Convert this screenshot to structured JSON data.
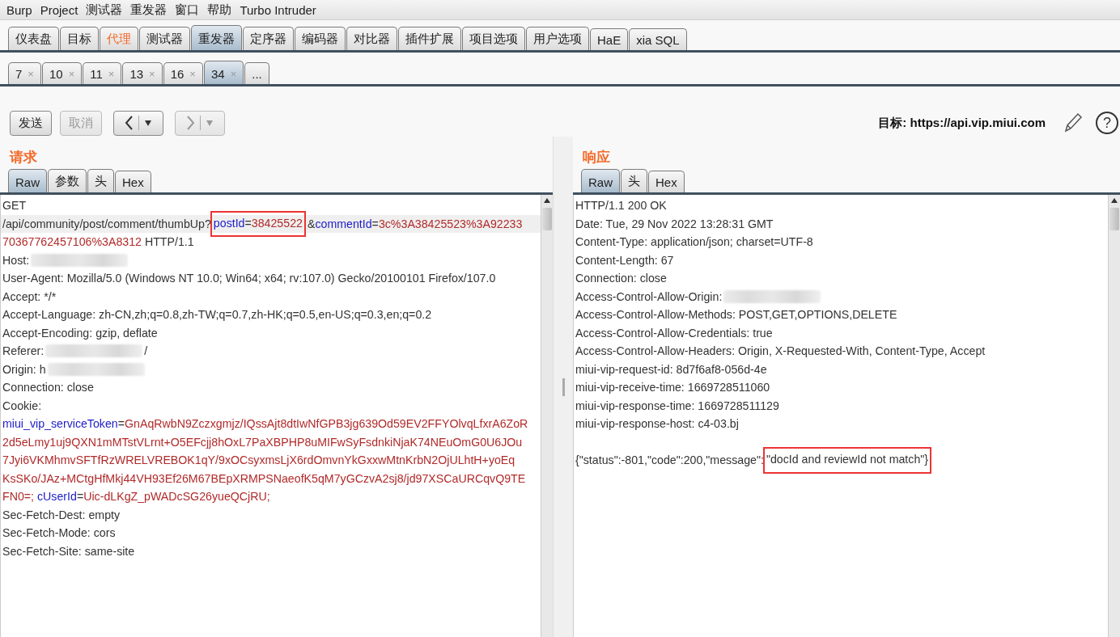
{
  "menu": [
    "Burp",
    "Project",
    "测试器",
    "重发器",
    "窗口",
    "帮助",
    "Turbo Intruder"
  ],
  "tool_tabs": [
    {
      "label": "仪表盘",
      "selected": false,
      "highlighted": false
    },
    {
      "label": "目标",
      "selected": false,
      "highlighted": false
    },
    {
      "label": "代理",
      "selected": false,
      "highlighted": true
    },
    {
      "label": "测试器",
      "selected": false,
      "highlighted": false
    },
    {
      "label": "重发器",
      "selected": true,
      "highlighted": false
    },
    {
      "label": "定序器",
      "selected": false,
      "highlighted": false
    },
    {
      "label": "编码器",
      "selected": false,
      "highlighted": false
    },
    {
      "label": "对比器",
      "selected": false,
      "highlighted": false
    },
    {
      "label": "插件扩展",
      "selected": false,
      "highlighted": false
    },
    {
      "label": "项目选项",
      "selected": false,
      "highlighted": false
    },
    {
      "label": "用户选项",
      "selected": false,
      "highlighted": false
    },
    {
      "label": "HaE",
      "selected": false,
      "highlighted": false
    },
    {
      "label": "xia SQL",
      "selected": false,
      "highlighted": false
    }
  ],
  "repeater_tabs": [
    {
      "label": "7",
      "close": "×",
      "selected": false
    },
    {
      "label": "10",
      "close": "×",
      "selected": false
    },
    {
      "label": "11",
      "close": "×",
      "selected": false
    },
    {
      "label": "13",
      "close": "×",
      "selected": false
    },
    {
      "label": "16",
      "close": "×",
      "selected": false
    },
    {
      "label": "34",
      "close": "×",
      "selected": true
    },
    {
      "label": "...",
      "selected": false
    }
  ],
  "toolbar": {
    "buttons": [
      {
        "kind": "text",
        "label": "发送",
        "disabled": false
      },
      {
        "kind": "text",
        "label": "取消",
        "disabled": true
      },
      {
        "kind": "back",
        "disabled": false
      },
      {
        "kind": "forward",
        "disabled": true
      }
    ],
    "target_label": "目标:",
    "target": "https://api.vip.miui.com",
    "help": "?"
  },
  "request": {
    "title": "请求",
    "tabs": [
      {
        "label": "Raw",
        "selected": true
      },
      {
        "label": "参数",
        "selected": false
      },
      {
        "label": "头",
        "selected": false
      },
      {
        "label": "Hex",
        "selected": false
      }
    ],
    "lines": [
      [
        {
          "kind": "plain",
          "text": "GET"
        }
      ],
      [
        {
          "kind": "plain",
          "text": "/api/community/post/comment/thumbUp?"
        },
        {
          "kind": "key",
          "text": "postId",
          "boxed": true
        },
        {
          "kind": "plain",
          "text": "=",
          "boxed": true
        },
        {
          "kind": "value",
          "text": "38425522",
          "boxed": true
        },
        {
          "kind": "plain",
          "text": "&"
        },
        {
          "kind": "key",
          "text": "commentId"
        },
        {
          "kind": "plain",
          "text": "="
        },
        {
          "kind": "value",
          "text": "3c%3A38425523%3A92233"
        }
      ],
      [
        {
          "kind": "value",
          "text": "70367762457106%3A8312"
        },
        {
          "kind": "plain",
          "text": " HTTP/1.1"
        }
      ],
      [
        {
          "kind": "plain",
          "text": "Host:"
        },
        {
          "kind": "redacted"
        }
      ],
      [
        {
          "kind": "plain",
          "text": "User-Agent: Mozilla/5.0 (Windows NT 10.0; Win64; x64; rv:107.0) Gecko/20100101 Firefox/107.0"
        }
      ],
      [
        {
          "kind": "plain",
          "text": "Accept: */*"
        }
      ],
      [
        {
          "kind": "plain",
          "text": "Accept-Language: zh-CN,zh;q=0.8,zh-TW;q=0.7,zh-HK;q=0.5,en-US;q=0.3,en;q=0.2"
        }
      ],
      [
        {
          "kind": "plain",
          "text": "Accept-Encoding: gzip, deflate"
        }
      ],
      [
        {
          "kind": "plain",
          "text": "Referer:"
        },
        {
          "kind": "redacted"
        },
        {
          "kind": "plain",
          "text": "/"
        }
      ],
      [
        {
          "kind": "plain",
          "text": "Origin: h"
        },
        {
          "kind": "redacted"
        }
      ],
      [
        {
          "kind": "plain",
          "text": "Connection: close"
        }
      ],
      [
        {
          "kind": "plain",
          "text": "Cookie:"
        }
      ],
      [
        {
          "kind": "key",
          "text": "miui_vip_serviceToken"
        },
        {
          "kind": "plain",
          "text": "="
        },
        {
          "kind": "value",
          "text": "GnAqRwbN9Zczxgmjz/IQssAjt8dtIwNfGPB3jg639Od59EV2FFYOlvqLfxrA6ZoR"
        }
      ],
      [
        {
          "kind": "value",
          "text": "2d5eLmy1uj9QXN1mMTstVLrnt+O5EFcjj8hOxL7PaXBPHP8uMIFwSyFsdnkiNjaK74NEuOmG0U6JOu"
        }
      ],
      [
        {
          "kind": "value",
          "text": "7Jyi6VKMhmvSFTfRzWRELVREBOK1qY/9xOCsyxmsLjX6rdOmvnYkGxxwMtnKrbN2OjULhtH+yoEq"
        }
      ],
      [
        {
          "kind": "value",
          "text": "KsSKo/JAz+MCtgHfMkj44VH93Ef26M67BEpXRMPSNaeofK5qM7yGCzvA2sj8/jd97XSCaURCqvQ9TE"
        }
      ],
      [
        {
          "kind": "value",
          "text": "FN0=; "
        },
        {
          "kind": "key",
          "text": "cUserId"
        },
        {
          "kind": "plain",
          "text": "="
        },
        {
          "kind": "value",
          "text": "Uic-dLKgZ_pWADcSG26yueQCjRU;"
        }
      ],
      [
        {
          "kind": "plain",
          "text": "Sec-Fetch-Dest: empty"
        }
      ],
      [
        {
          "kind": "plain",
          "text": "Sec-Fetch-Mode: cors"
        }
      ],
      [
        {
          "kind": "plain",
          "text": "Sec-Fetch-Site: same-site"
        }
      ]
    ]
  },
  "response": {
    "title": "响应",
    "tabs": [
      {
        "label": "Raw",
        "selected": true
      },
      {
        "label": "头",
        "selected": false
      },
      {
        "label": "Hex",
        "selected": false
      }
    ],
    "lines": [
      [
        {
          "kind": "plain",
          "text": "HTTP/1.1 200 OK"
        }
      ],
      [
        {
          "kind": "plain",
          "text": "Date: Tue, 29 Nov 2022 13:28:31 GMT"
        }
      ],
      [
        {
          "kind": "plain",
          "text": "Content-Type: application/json; charset=UTF-8"
        }
      ],
      [
        {
          "kind": "plain",
          "text": "Content-Length: 67"
        }
      ],
      [
        {
          "kind": "plain",
          "text": "Connection: close"
        }
      ],
      [
        {
          "kind": "plain",
          "text": "Access-Control-Allow-Origin:"
        },
        {
          "kind": "redacted"
        }
      ],
      [
        {
          "kind": "plain",
          "text": "Access-Control-Allow-Methods: POST,GET,OPTIONS,DELETE"
        }
      ],
      [
        {
          "kind": "plain",
          "text": "Access-Control-Allow-Credentials: true"
        }
      ],
      [
        {
          "kind": "plain",
          "text": "Access-Control-Allow-Headers: Origin, X-Requested-With, Content-Type, Accept"
        }
      ],
      [
        {
          "kind": "plain",
          "text": "miui-vip-request-id: 8d7f6af8-056d-4e"
        }
      ],
      [
        {
          "kind": "plain",
          "text": "miui-vip-receive-time: 1669728511060"
        }
      ],
      [
        {
          "kind": "plain",
          "text": "miui-vip-response-time: 1669728511129"
        }
      ],
      [
        {
          "kind": "plain",
          "text": "miui-vip-response-host: c4-03.bj"
        }
      ],
      [
        {
          "kind": "blank"
        }
      ],
      [
        {
          "kind": "plain",
          "text": "{\"status\":-801,\"code\":200,\"message\":"
        },
        {
          "kind": "plain",
          "text": "\"docId and reviewId not match\"}",
          "boxed": true
        }
      ]
    ]
  }
}
